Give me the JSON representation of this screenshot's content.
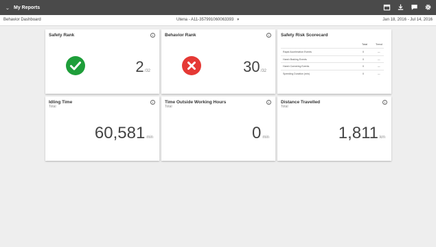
{
  "topbar": {
    "title": "My Reports",
    "icons": [
      "calendar-icon",
      "download-icon",
      "chat-icon",
      "settings-icon"
    ]
  },
  "subbar": {
    "dashboard_label": "Behavior Dashboard",
    "vehicle_label": "Utena - A11-357991060063393",
    "date_range": "Jan 18, 2016 - Jul 14, 2016"
  },
  "cards": {
    "safety_rank": {
      "title": "Safety Rank",
      "rank": "2",
      "out_of": "/32",
      "status": "good",
      "status_color": "#1e9e3a"
    },
    "behavior_rank": {
      "title": "Behavior Rank",
      "rank": "30",
      "out_of": "/32",
      "status": "bad",
      "status_color": "#e53935"
    },
    "scorecard": {
      "title": "Safety Risk Scorecard",
      "col_total": "Total",
      "col_trend": "Trend",
      "rows": [
        {
          "label": "Rapid Acceleration Events",
          "total": "0",
          "trend": "—"
        },
        {
          "label": "Harsh Braking Events",
          "total": "0",
          "trend": "—"
        },
        {
          "label": "Harsh Cornering Events",
          "total": "0",
          "trend": "—"
        },
        {
          "label": "Speeding Duration (min)",
          "total": "0",
          "trend": "—"
        }
      ]
    },
    "idling": {
      "title": "Idling Time",
      "subtitle": "Total",
      "value": "60,581",
      "unit": "min"
    },
    "outside_hours": {
      "title": "Time Outside Working Hours",
      "subtitle": "Total",
      "value": "0",
      "unit": "min"
    },
    "distance": {
      "title": "Distance Travelled",
      "subtitle": "Total",
      "value": "1,811",
      "unit": "km"
    }
  },
  "info_symbol": "i",
  "chevron_symbol": "⌄"
}
